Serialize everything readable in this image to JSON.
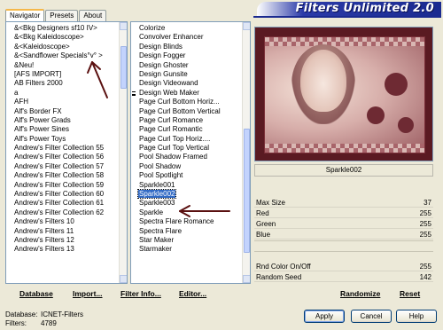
{
  "header": {
    "title": "Filters Unlimited 2.0"
  },
  "tabs": [
    {
      "label": "Navigator",
      "active": true
    },
    {
      "label": "Presets",
      "active": false
    },
    {
      "label": "About",
      "active": false
    }
  ],
  "categories": [
    "&<Bkg Designers sf10 IV>",
    "&<Bkg Kaleidoscope>",
    "&<Kaleidoscope>",
    "&<Sandflower Specials°v° >",
    "&Neu!",
    "[AFS IMPORT]",
    "AB Filters 2000",
    "a",
    "AFH",
    "Alf's Border FX",
    "Alf's Power Grads",
    "Alf's Power Sines",
    "Alf's Power Toys",
    "Andrew's Filter Collection 55",
    "Andrew's Filter Collection 56",
    "Andrew's Filter Collection 57",
    "Andrew's Filter Collection 58",
    "Andrew's Filter Collection 59",
    "Andrew's Filter Collection 60",
    "Andrew's Filter Collection 61",
    "Andrew's Filter Collection 62",
    "Andrew's Filters 10",
    "Andrew's Filters 11",
    "Andrew's Filters 12",
    "Andrew's Filters 13"
  ],
  "filters": [
    {
      "label": "Colorize",
      "marker": false
    },
    {
      "label": "Convolver Enhancer",
      "marker": false
    },
    {
      "label": "Design Blinds",
      "marker": false
    },
    {
      "label": "Design Fogger",
      "marker": false
    },
    {
      "label": "Design Ghoster",
      "marker": false
    },
    {
      "label": "Design Gunsite",
      "marker": false
    },
    {
      "label": "Design Videowand",
      "marker": false
    },
    {
      "label": "Design Web Maker",
      "marker": true
    },
    {
      "label": "Page Curl Bottom Horiz...",
      "marker": false
    },
    {
      "label": "Page Curl Bottom Vertical",
      "marker": false
    },
    {
      "label": "Page Curl Romance",
      "marker": false
    },
    {
      "label": "Page Curl Romantic",
      "marker": false
    },
    {
      "label": "Page Curl Top Horiz....",
      "marker": false
    },
    {
      "label": "Page Curl Top Vertical",
      "marker": false
    },
    {
      "label": "Pool Shadow Framed",
      "marker": false
    },
    {
      "label": "Pool Shadow",
      "marker": false
    },
    {
      "label": "Pool Spotlight",
      "marker": false
    },
    {
      "label": "Sparkle001",
      "marker": false
    },
    {
      "label": "Sparkle002",
      "marker": false,
      "selected": true
    },
    {
      "label": "Sparkle003",
      "marker": false
    },
    {
      "label": "Sparkle",
      "marker": false
    },
    {
      "label": "Spectra Flare Romance",
      "marker": false
    },
    {
      "label": "Spectra Flare",
      "marker": false
    },
    {
      "label": "Star Maker",
      "marker": false
    },
    {
      "label": "Starmaker",
      "marker": false
    }
  ],
  "preview": {
    "caption": "Sparkle002"
  },
  "params": [
    {
      "label": "Max Size",
      "value": "37"
    },
    {
      "label": "Red",
      "value": "255"
    },
    {
      "label": "Green",
      "value": "255"
    },
    {
      "label": "Blue",
      "value": "255"
    },
    {
      "label": "Rnd Color On/Off",
      "value": "255"
    },
    {
      "label": "Random Seed",
      "value": "142"
    }
  ],
  "actions": {
    "database": "Database",
    "import": "Import...",
    "filter_info": "Filter Info...",
    "editor": "Editor...",
    "randomize": "Randomize",
    "reset": "Reset"
  },
  "status": {
    "database_label": "Database:",
    "database_value": "ICNET-Filters",
    "filters_label": "Filters:",
    "filters_value": "4789"
  },
  "buttons": {
    "apply": "Apply",
    "cancel": "Cancel",
    "help": "Help"
  },
  "colors": {
    "accent": "#1a2a90",
    "selection": "#316ac5",
    "annotation_arrow": "#5a1010"
  }
}
